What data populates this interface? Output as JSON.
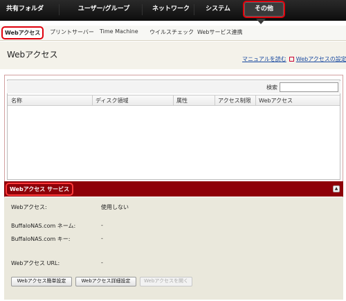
{
  "top_nav": [
    {
      "label": "共有フォルダー"
    },
    {
      "label": "ユーザー/グループ"
    },
    {
      "label": "ネットワーク"
    },
    {
      "label": "システム"
    },
    {
      "label": "その他"
    }
  ],
  "sub_nav": [
    {
      "label": "Webアクセス"
    },
    {
      "label": "プリントサーバー"
    },
    {
      "label": "Time Machine"
    },
    {
      "label": "ウイルスチェック"
    },
    {
      "label": "Webサービス連携"
    }
  ],
  "page": {
    "title": "Webアクセス",
    "link_manual": "マニュアルを読む",
    "link_settings": "Webアクセスの設定"
  },
  "table": {
    "search_label": "検索",
    "search_value": "",
    "columns": [
      "名称",
      "ディスク領域",
      "属性",
      "アクセス制限",
      "Webアクセス"
    ]
  },
  "section": {
    "title": "Webアクセス サービス",
    "collapse_symbol": "▲"
  },
  "details": [
    {
      "label": "Webアクセス:",
      "value": "使用しない"
    },
    {
      "label": "BuffaloNAS.com ネーム:",
      "value": "-"
    },
    {
      "label": "BuffaloNAS.com キー:",
      "value": "-"
    },
    {
      "label": "Webアクセス URL:",
      "value": "-"
    }
  ],
  "buttons": {
    "easy_setup": "Webアクセス簡単設定",
    "detail_setup": "Webアクセス詳細設定",
    "open": "Webアクセスを開く"
  },
  "colors": {
    "accent": "#e0000c",
    "section_header": "#8e0008"
  }
}
